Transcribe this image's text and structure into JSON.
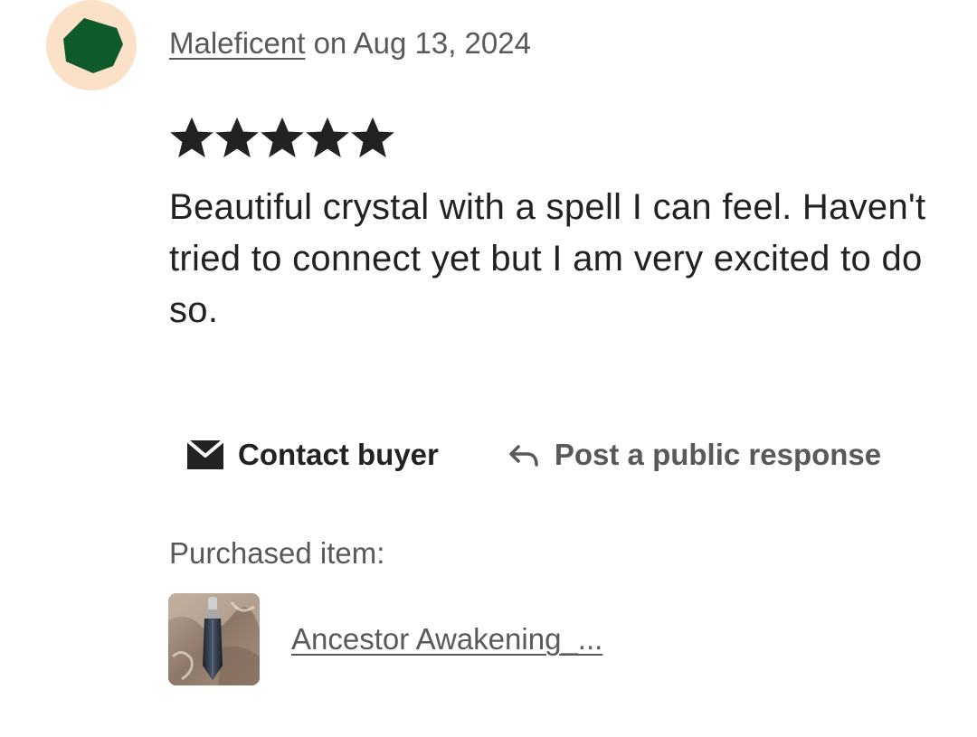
{
  "review": {
    "author": "Maleficent",
    "date_text": "on Aug 13, 2024",
    "rating": 5,
    "max_rating": 5,
    "text": "Beautiful crystal with a spell I can feel. Haven't tried to connect yet but I am very excited to do so.",
    "avatar": {
      "background_color": "#fbe1c7",
      "shape_color": "#0e5a2a",
      "icon": "pentagon-avatar-icon"
    }
  },
  "actions": {
    "contact_label": "Contact buyer",
    "contact_icon": "mail-icon",
    "respond_label": "Post a public response",
    "respond_icon": "reply-arrow-icon"
  },
  "purchased": {
    "label": "Purchased item:",
    "item_title": "Ancestor Awakening_...",
    "thumbnail_icon": "crystal-pendant-photo"
  },
  "colors": {
    "text_primary": "#222222",
    "text_secondary": "#595959",
    "star": "#222222"
  }
}
